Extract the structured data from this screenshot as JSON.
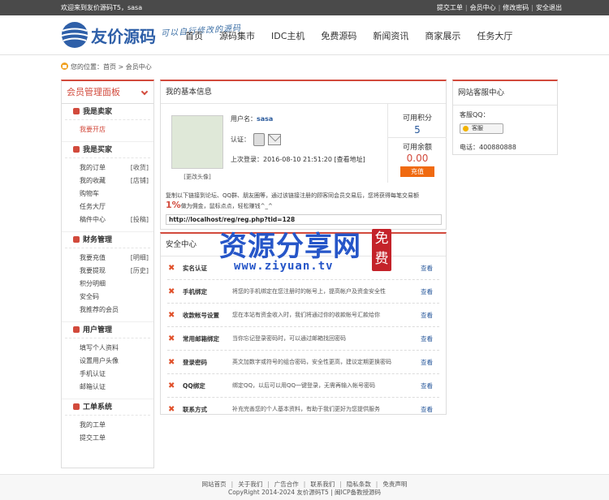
{
  "topbar": {
    "welcome": "欢迎来到友价源码T5，sasa",
    "links": [
      "提交工单",
      "会员中心",
      "修改密码",
      "安全退出"
    ]
  },
  "header": {
    "logo_text": "友价源码",
    "slogan": "可以自行修改的源码",
    "nav": [
      "首页",
      "源码集市",
      "IDC主机",
      "免费源码",
      "新闻资讯",
      "商家展示",
      "任务大厅"
    ]
  },
  "breadcrumb": "您的位置：首页 > 会员中心",
  "sidebar": {
    "title": "会员管理面板",
    "sections": [
      {
        "title": "我是卖家",
        "items": [
          {
            "label": "我要开店",
            "tag": "",
            "active": true
          }
        ]
      },
      {
        "title": "我是买家",
        "items": [
          {
            "label": "我的订单",
            "tag": "[收货]"
          },
          {
            "label": "我的收藏",
            "tag": "[店铺]"
          },
          {
            "label": "购物车",
            "tag": ""
          },
          {
            "label": "任务大厅",
            "tag": ""
          },
          {
            "label": "稿件中心",
            "tag": "[投稿]"
          }
        ]
      },
      {
        "title": "财务管理",
        "items": [
          {
            "label": "我要充值",
            "tag": "[明细]"
          },
          {
            "label": "我要提现",
            "tag": "[历史]"
          },
          {
            "label": "积分明细",
            "tag": ""
          },
          {
            "label": "安全码",
            "tag": ""
          },
          {
            "label": "我推荐的会员",
            "tag": ""
          }
        ]
      },
      {
        "title": "用户管理",
        "items": [
          {
            "label": "填写个人资料",
            "tag": ""
          },
          {
            "label": "设置用户头像",
            "tag": ""
          },
          {
            "label": "手机认证",
            "tag": ""
          },
          {
            "label": "邮箱认证",
            "tag": ""
          }
        ]
      },
      {
        "title": "工单系统",
        "items": [
          {
            "label": "我的工单",
            "tag": ""
          },
          {
            "label": "提交工单",
            "tag": ""
          }
        ]
      }
    ]
  },
  "basic_info": {
    "title": "我的基本信息",
    "change_avatar": "[更改头像]",
    "username_label": "用户名：",
    "username": "sasa",
    "verify_label": "认证：",
    "last_login_label": "上次登录：",
    "last_login": "2016-08-10 21:51:20",
    "view_ip": "[查看地址]",
    "points_label": "可用积分",
    "points_value": "5",
    "balance_label": "可用余额",
    "balance_value": "0.00",
    "recharge_label": "充值",
    "invite_text_1": "复制以下链接到论坛、QQ群、朋友圈等，通过该链接注册的顾客同会员交易后，您将获得每笔交易额",
    "invite_pct": "1%",
    "invite_text_2": "做为佣金，鼠标点点，轻松赚钱^_^",
    "invite_link": "http://localhost/reg/reg.php?tid=128"
  },
  "security": {
    "title": "安全中心",
    "rows": [
      {
        "name": "实名认证",
        "desc": "",
        "action": "查看"
      },
      {
        "name": "手机绑定",
        "desc": "将您的手机绑定在您注册时的帐号上，提高帐户及资金安全性",
        "action": "查看"
      },
      {
        "name": "收款帐号设置",
        "desc": "您在本站有资金收入时，我们将通过你的收款帐号汇款给你",
        "action": "查看"
      },
      {
        "name": "常用邮箱绑定",
        "desc": "当你忘记登录密码时，可以通过邮箱找回密码",
        "action": "查看"
      },
      {
        "name": "登录密码",
        "desc": "英文加数字或符号的组合密码，安全性更高，建议定期更换密码",
        "action": "查看"
      },
      {
        "name": "QQ绑定",
        "desc": "绑定QQ，以后可以用QQ一键登录，无需再输入帐号密码",
        "action": "查看"
      },
      {
        "name": "联系方式",
        "desc": "补充完善您的个人基本资料，有助于我们更好为您提供服务",
        "action": "查看"
      }
    ]
  },
  "customer_service": {
    "title": "网站客服中心",
    "qq_label": "客服QQ：",
    "qq_button": "客服",
    "phone": "电话：400880888"
  },
  "watermark": {
    "text": "资源分享网",
    "url": "www.ziyuan.tv",
    "free": "免费"
  },
  "footer": {
    "links": [
      "网站首页",
      "关于我们",
      "广告合作",
      "联系我们",
      "隐私条款",
      "免责声明"
    ],
    "copyright": "CopyRight 2014-2024 友价源码T5 | 闽ICP备教授源码"
  }
}
